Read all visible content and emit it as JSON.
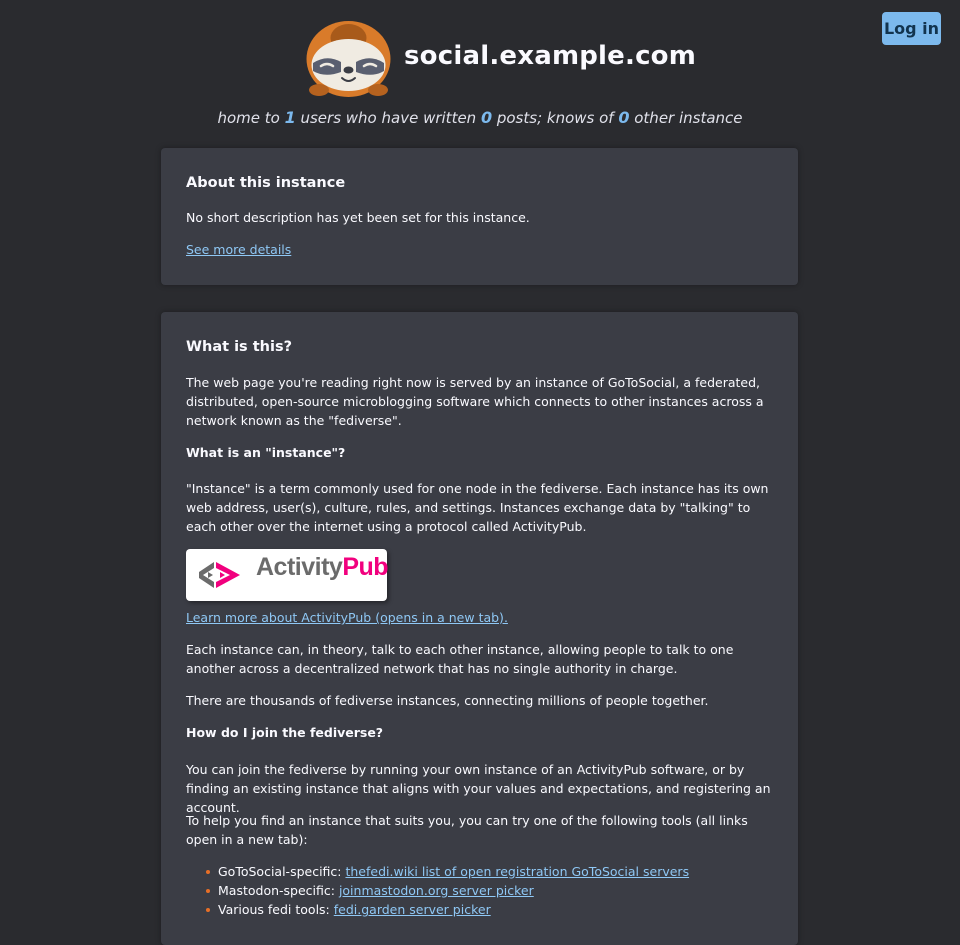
{
  "header": {
    "site_title": "social.example.com",
    "login_label": "Log in",
    "stats": {
      "prefix": "home to ",
      "users": "1",
      "mid1": " users who have written ",
      "posts": "0",
      "mid2": " posts; knows of ",
      "instances": "0",
      "suffix": " other instance"
    }
  },
  "about": {
    "heading": "About this instance",
    "description": "No short description has yet been set for this instance.",
    "more_link": "See more details"
  },
  "what": {
    "heading": "What is this?",
    "intro": "The web page you're reading right now is served by an instance of GoToSocial, a federated, distributed, open-source microblogging software which connects to other instances across a network known as the \"fediverse\".",
    "instance_heading": "What is an \"instance\"?",
    "instance_text": "\"Instance\" is a term commonly used for one node in the fediverse. Each instance has its own web address, user(s), culture, rules, and settings. Instances exchange data by \"talking\" to each other over the internet using a protocol called ActivityPub.",
    "activitypub_logo_part1": "Activity",
    "activitypub_logo_part2": "Pub",
    "activitypub_link": "Learn more about ActivityPub (opens in a new tab).",
    "talk_text": "Each instance can, in theory, talk to each other instance, allowing people to talk to one another across a decentralized network that has no single authority in charge.",
    "thousands_text": "There are thousands of fediverse instances, connecting millions of people together.",
    "join_heading": "How do I join the fediverse?",
    "join_text": "You can join the fediverse by running your own instance of an ActivityPub software, or by finding an existing instance that aligns with your values and expectations, and registering an account.",
    "help_text": "To help you find an instance that suits you, you can try one of the following tools (all links open in a new tab):",
    "tools": [
      {
        "label": "GoToSocial-specific: ",
        "link": "thefedi.wiki list of open registration GoToSocial servers"
      },
      {
        "label": "Mastodon-specific: ",
        "link": "joinmastodon.org server picker"
      },
      {
        "label": "Various fedi tools: ",
        "link": "fedi.garden server picker"
      }
    ]
  },
  "colors": {
    "background": "#2a2b2f",
    "card": "#3b3d45",
    "accent": "#7cb9ed",
    "link": "#8fc8f5",
    "bullet": "#e76f27",
    "activitypub_pink": "#f1007e"
  }
}
